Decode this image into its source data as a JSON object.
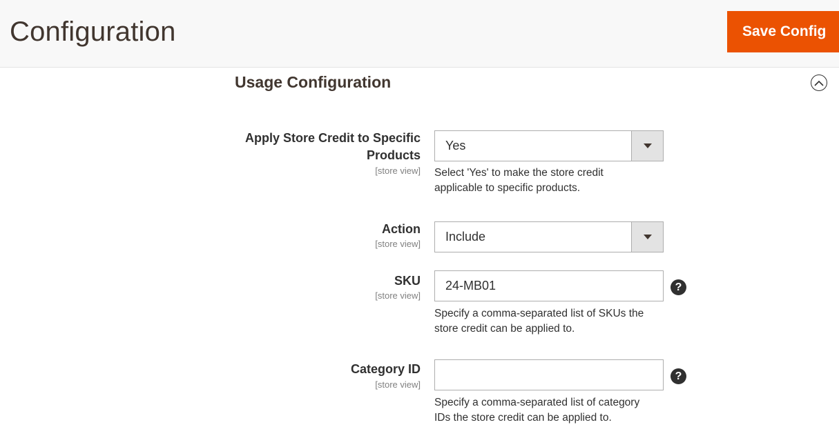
{
  "header": {
    "title": "Configuration",
    "save_label": "Save Config"
  },
  "section": {
    "title": "Usage Configuration",
    "collapse_icon": "chevron-up-circle-icon"
  },
  "fields": {
    "apply_specific": {
      "label_line1": "Apply Store Credit to Specific",
      "label_line2": "Products",
      "scope": "[store view]",
      "value": "Yes",
      "note_line1": "Select 'Yes' to make the store credit",
      "note_line2": "applicable to specific products."
    },
    "action": {
      "label": "Action",
      "scope": "[store view]",
      "value": "Include"
    },
    "sku": {
      "label": "SKU",
      "scope": "[store view]",
      "value": "24-MB01",
      "help": "?",
      "note_line1": "Specify a comma-separated list of SKUs the",
      "note_line2": "store credit can be applied to."
    },
    "category": {
      "label": "Category ID",
      "scope": "[store view]",
      "value": "",
      "help": "?",
      "note_line1": "Specify a comma-separated list of category",
      "note_line2": "IDs the store credit can be applied to."
    }
  },
  "colors": {
    "accent": "#eb5202",
    "text": "#303030",
    "title": "#41362f",
    "scope": "#808080"
  }
}
